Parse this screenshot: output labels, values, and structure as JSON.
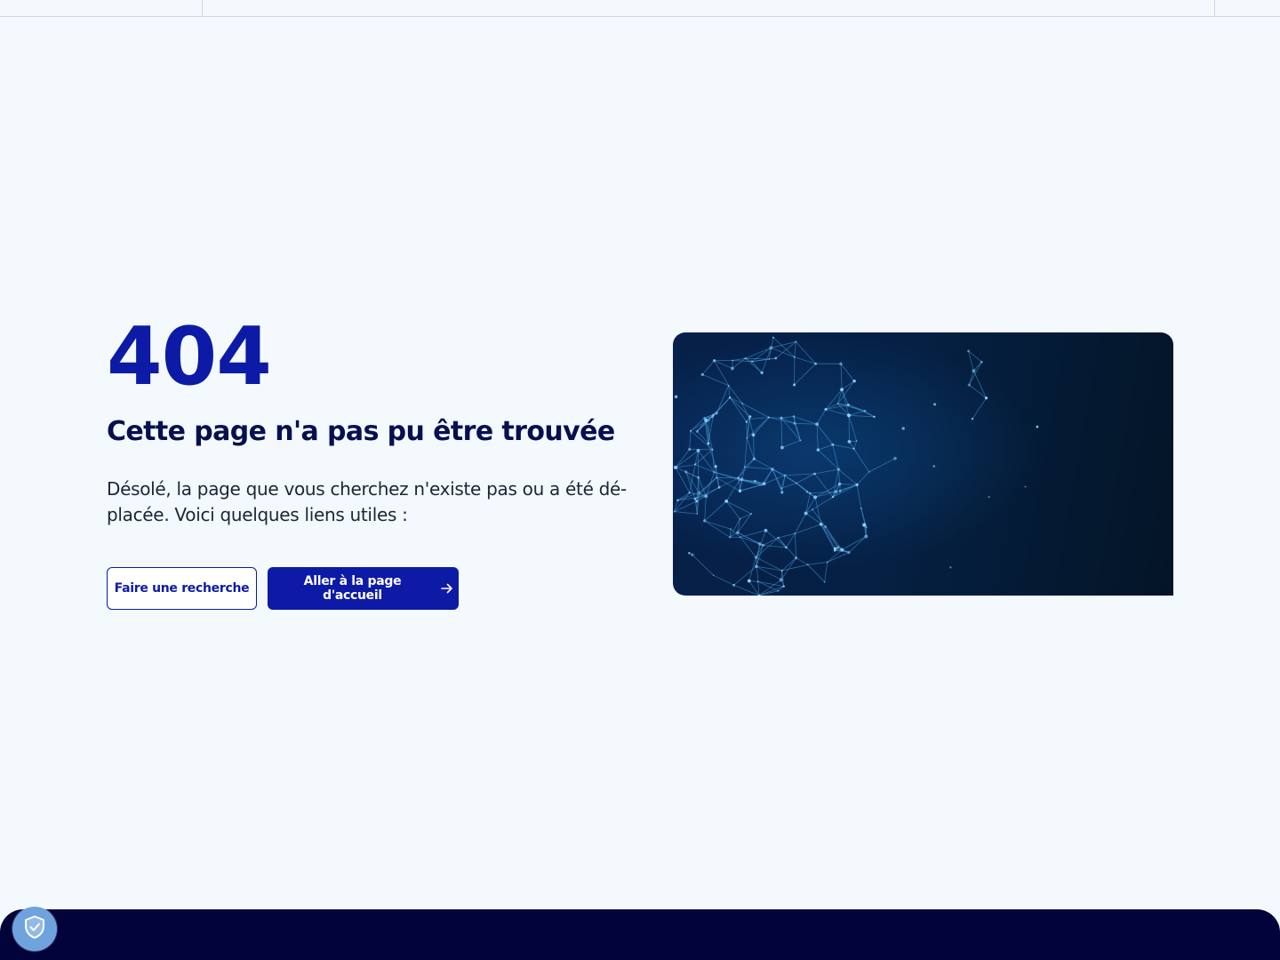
{
  "error": {
    "code": "404",
    "title": "Cette page n'a pas pu être trouvée",
    "description": "Désolé, la page que vous cherchez n'existe pas ou a été dé-placée. Voici quelques liens utiles :"
  },
  "actions": {
    "search_label": "Faire une recherche",
    "home_label": "Aller à la page d'accueil",
    "home_icon": "arrow-right-icon"
  },
  "consent": {
    "icon": "shield-check-icon"
  },
  "colors": {
    "accent": "#0c1aa6",
    "heading": "#07104f",
    "background": "#f3f9fd",
    "footer": "#03033b",
    "badge": "#6ea3de"
  }
}
